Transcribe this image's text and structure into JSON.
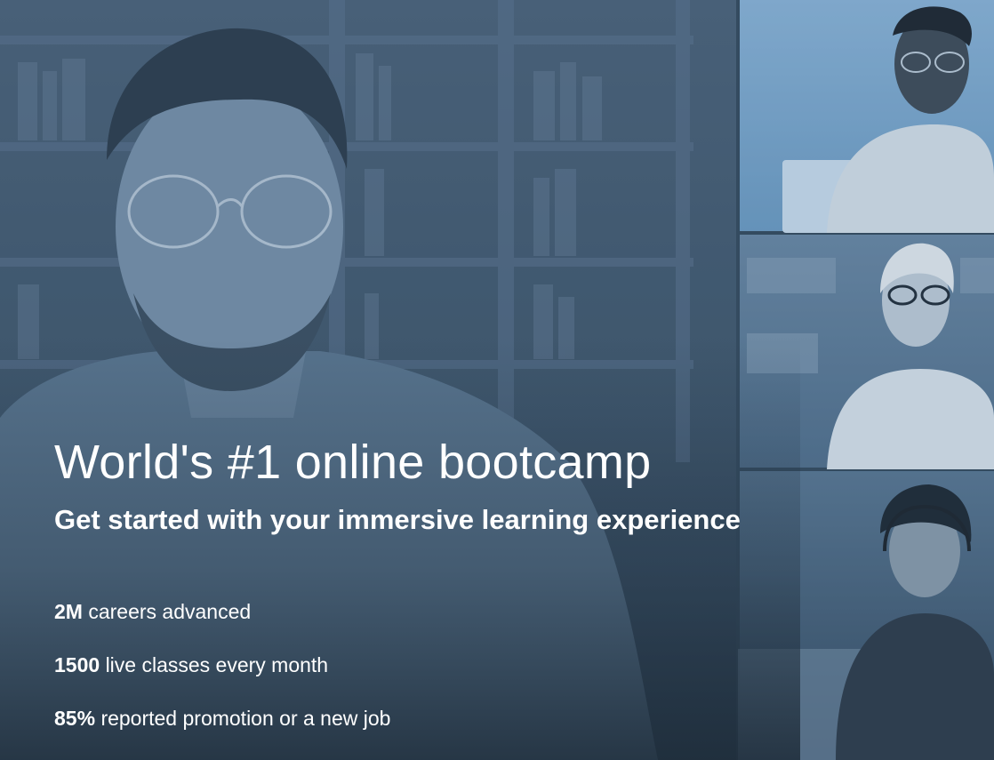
{
  "hero": {
    "headline": "World's #1 online bootcamp",
    "subheadline": "Get started with your immersive learning experience",
    "stats": [
      {
        "value": "2M",
        "label": "careers advanced"
      },
      {
        "value": "1500",
        "label": "live classes every month"
      },
      {
        "value": "85%",
        "label": "reported promotion or a new job"
      }
    ]
  },
  "theme": {
    "overlay": "#2e4256",
    "tint_light": "#a8d0f0",
    "text": "#ffffff"
  }
}
